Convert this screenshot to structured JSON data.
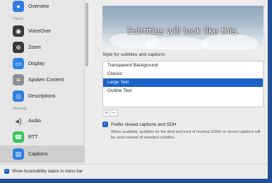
{
  "sidebar": {
    "items": [
      {
        "label": "Overview",
        "icon": "overview-icon",
        "color": "#2f7de1"
      },
      {
        "label": "VoiceOver",
        "icon": "voiceover-icon",
        "color": "#3a3a3a"
      },
      {
        "label": "Zoom",
        "icon": "zoom-icon",
        "color": "#3a3a3a"
      },
      {
        "label": "Display",
        "icon": "display-icon",
        "color": "#2f86e4"
      },
      {
        "label": "Spoken Content",
        "icon": "spoken-content-icon",
        "color": "#8e8e93"
      },
      {
        "label": "Descriptions",
        "icon": "descriptions-icon",
        "color": "#2f7de1"
      },
      {
        "label": "Audio",
        "icon": "audio-icon",
        "color": "#4a4a4a"
      },
      {
        "label": "RTT",
        "icon": "rtt-icon",
        "color": "#34c759"
      },
      {
        "label": "Captions",
        "icon": "captions-icon",
        "color": "#2f7de1"
      }
    ],
    "sections": {
      "vision": "Vision",
      "hearing": "Hearing"
    }
  },
  "preview": {
    "text": "Subtitles will look like this."
  },
  "style": {
    "label": "Style for subtitles and captions:",
    "options": [
      "Transparent Background",
      "Classic",
      "Large Text",
      "Outline Text"
    ],
    "selected": "Large Text"
  },
  "buttons": {
    "add": "+",
    "remove": "−"
  },
  "closed_captions": {
    "label": "Prefer closed captions and SDH",
    "checked": true,
    "description": "When available, subtitles for the deaf and hard of hearing (SDH) or closed captions will be used instead of standard subtitles."
  },
  "bottom": {
    "label": "Show Accessibility status in menu bar",
    "checked": true
  },
  "colors": {
    "accent": "#1a62c9",
    "desktop": "#1f4f93"
  }
}
